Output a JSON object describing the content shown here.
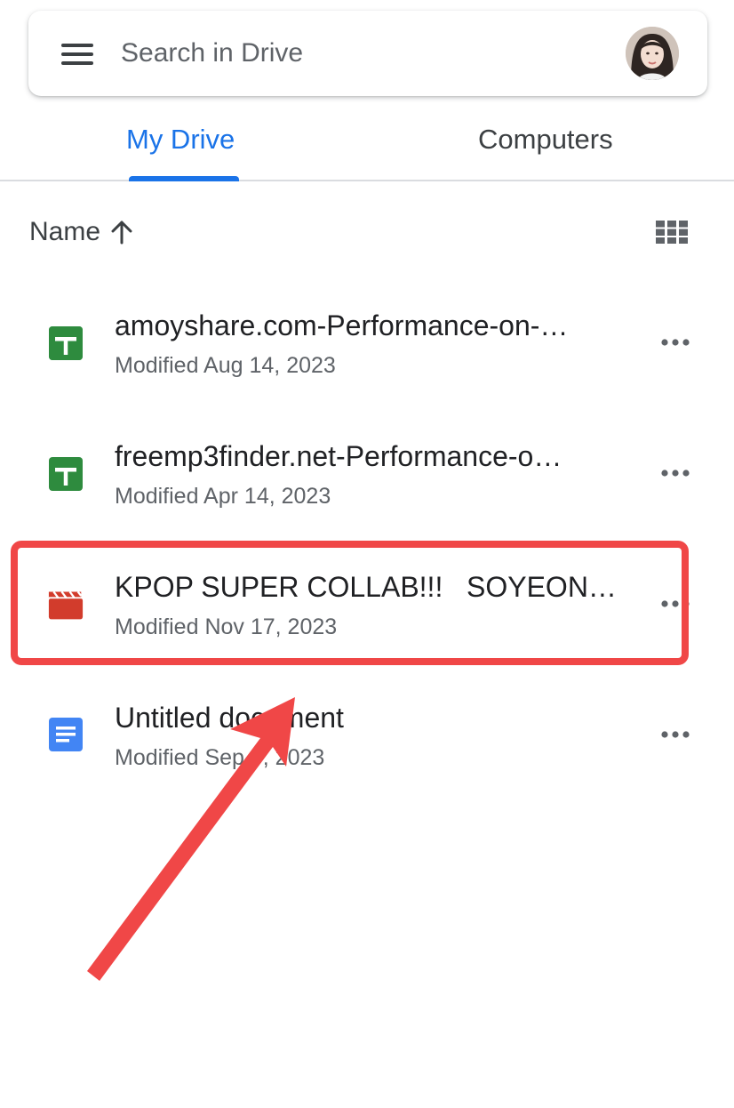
{
  "search": {
    "placeholder": "Search in Drive"
  },
  "tabs": [
    {
      "label": "My Drive",
      "active": true
    },
    {
      "label": "Computers",
      "active": false
    }
  ],
  "sort": {
    "label": "Name",
    "direction_icon": "arrow-up-icon",
    "view_toggle_icon": "grid-view-icon"
  },
  "files": [
    {
      "name": "amoyshare.com-Performance-on-…",
      "meta": "Modified Aug 14, 2023",
      "type_icon": "google-sheets-icon"
    },
    {
      "name": "freemp3finder.net-Performance-o…",
      "meta": "Modified Apr 14, 2023",
      "type_icon": "google-sheets-icon"
    },
    {
      "name": "KPOP SUPER COLLAB!!!   SOYEON…",
      "meta": "Modified Nov 17, 2023",
      "type_icon": "video-icon"
    },
    {
      "name": "Untitled document",
      "meta": "Modified Sep 5, 2023",
      "type_icon": "google-docs-icon"
    }
  ],
  "colors": {
    "accent": "#1a73e8",
    "sheets_green": "#188038",
    "video_red": "#d93025",
    "docs_blue": "#4285f4",
    "annotation_red": "#f04747"
  }
}
